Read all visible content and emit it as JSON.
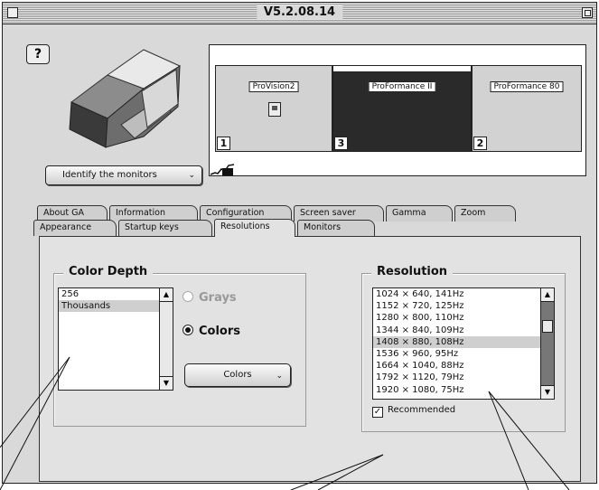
{
  "window": {
    "title": "V5.2.08.14"
  },
  "controls": {
    "help_label": "?",
    "identify_label": "Identify the monitors",
    "identify_chevron": "⌄"
  },
  "monitors": [
    {
      "label": "ProVision2",
      "number": "1"
    },
    {
      "label": "ProFormance II",
      "number": "3"
    },
    {
      "label": "ProFormance 80",
      "number": "2"
    }
  ],
  "tabs_back": [
    "About GA",
    "Information",
    "Configuration",
    "Screen saver",
    "Gamma",
    "Zoom"
  ],
  "tabs_front": [
    "Appearance",
    "Startup keys",
    "Resolutions",
    "Monitors"
  ],
  "active_tab": "Resolutions",
  "color_depth": {
    "title": "Color Depth",
    "items": [
      "256",
      "Thousands"
    ],
    "selected": "Thousands",
    "radio_grays": "Grays",
    "radio_colors": "Colors",
    "colors_button": "Colors",
    "colors_chevron": "⌄"
  },
  "resolution": {
    "title": "Resolution",
    "items": [
      "1024 × 640, 141Hz",
      "1152 × 720, 125Hz",
      "1280 × 800, 110Hz",
      "1344 × 840, 109Hz",
      "1408 × 880, 108Hz",
      "1536 × 960, 95Hz",
      "1664 × 1040, 88Hz",
      "1792 × 1120, 79Hz",
      "1920 × 1080, 75Hz"
    ],
    "selected": "1408 × 880, 108Hz",
    "recommended_label": "Recommended",
    "recommended_checked": true
  },
  "icons": {
    "scroll_up": "▲",
    "scroll_down": "▼",
    "check": "✓"
  }
}
